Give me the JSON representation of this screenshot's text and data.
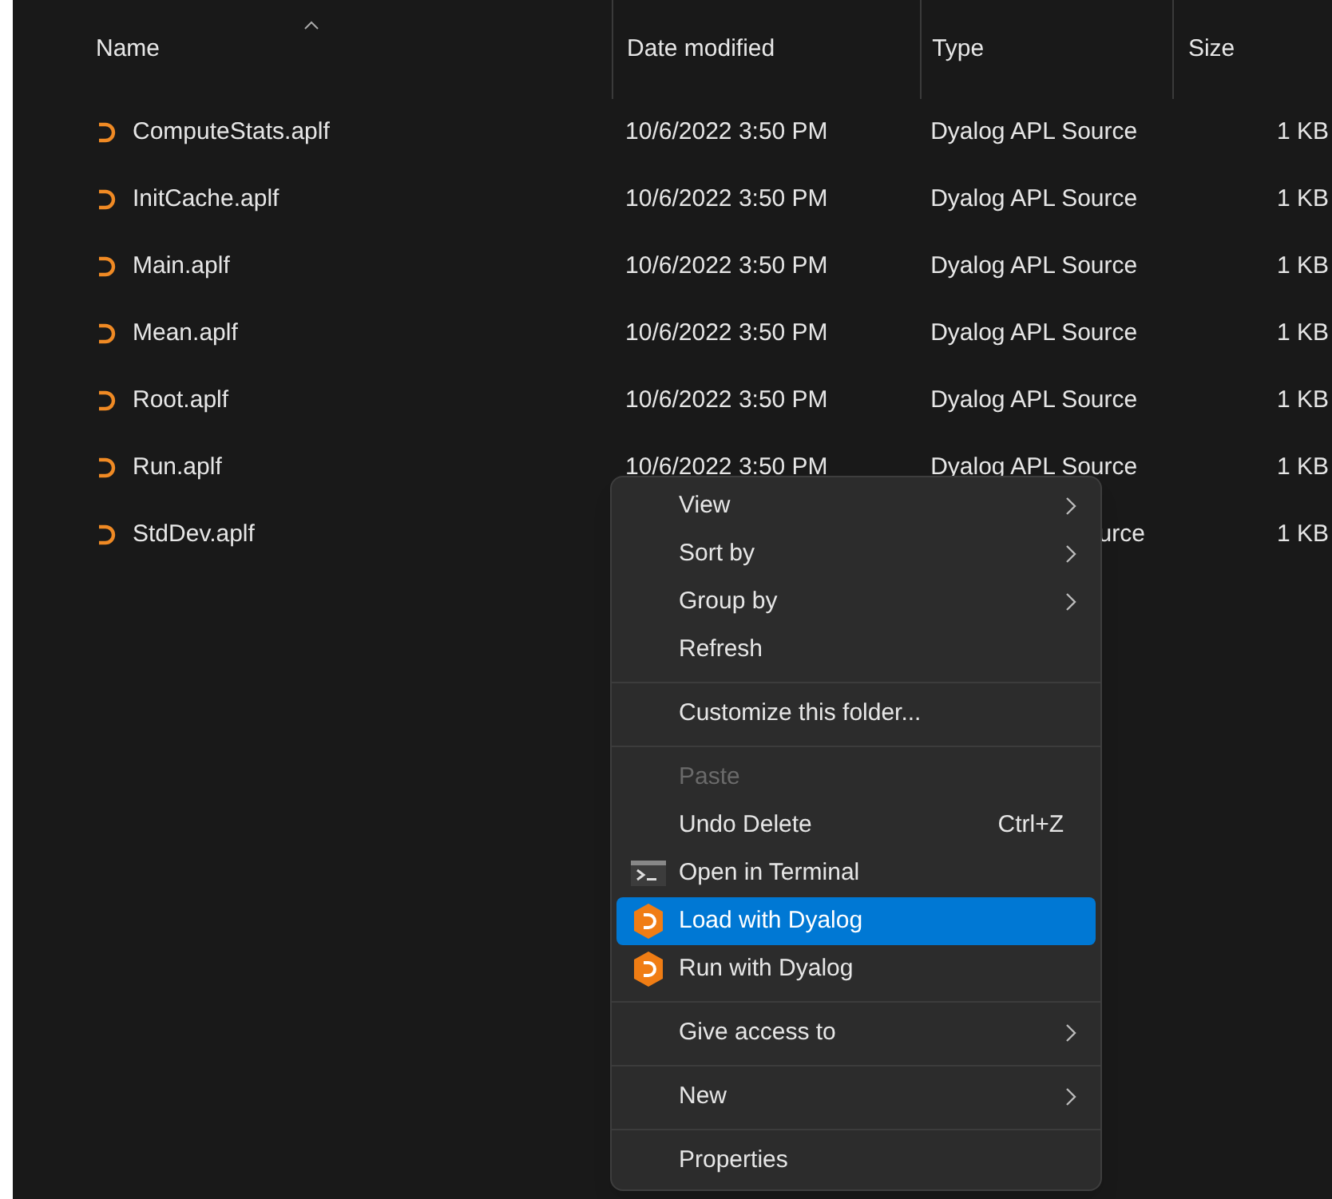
{
  "table": {
    "columns": [
      {
        "label": "Name",
        "sorted": true
      },
      {
        "label": "Date modified",
        "sorted": false
      },
      {
        "label": "Type",
        "sorted": false
      },
      {
        "label": "Size",
        "sorted": false
      }
    ],
    "rows": [
      {
        "name": "ComputeStats.aplf",
        "date": "10/6/2022 3:50 PM",
        "type": "Dyalog APL Source",
        "size": "1 KB"
      },
      {
        "name": "InitCache.aplf",
        "date": "10/6/2022 3:50 PM",
        "type": "Dyalog APL Source",
        "size": "1 KB"
      },
      {
        "name": "Main.aplf",
        "date": "10/6/2022 3:50 PM",
        "type": "Dyalog APL Source",
        "size": "1 KB"
      },
      {
        "name": "Mean.aplf",
        "date": "10/6/2022 3:50 PM",
        "type": "Dyalog APL Source",
        "size": "1 KB"
      },
      {
        "name": "Root.aplf",
        "date": "10/6/2022 3:50 PM",
        "type": "Dyalog APL Source",
        "size": "1 KB"
      },
      {
        "name": "Run.aplf",
        "date": "10/6/2022 3:50 PM",
        "type": "Dyalog APL Source",
        "size": "1 KB"
      },
      {
        "name": "StdDev.aplf",
        "type_visible_end": "urce",
        "size": "1 KB"
      }
    ]
  },
  "context_menu": {
    "items": [
      {
        "kind": "item",
        "label": "View",
        "submenu": true,
        "disabled": false,
        "selected": false
      },
      {
        "kind": "item",
        "label": "Sort by",
        "submenu": true,
        "disabled": false,
        "selected": false
      },
      {
        "kind": "item",
        "label": "Group by",
        "submenu": true,
        "disabled": false,
        "selected": false
      },
      {
        "kind": "item",
        "label": "Refresh",
        "submenu": false,
        "disabled": false,
        "selected": false
      },
      {
        "kind": "separator"
      },
      {
        "kind": "item",
        "label": "Customize this folder...",
        "submenu": false,
        "disabled": false,
        "selected": false
      },
      {
        "kind": "separator"
      },
      {
        "kind": "item",
        "label": "Paste",
        "submenu": false,
        "disabled": true,
        "selected": false
      },
      {
        "kind": "item",
        "label": "Undo Delete",
        "shortcut": "Ctrl+Z",
        "submenu": false,
        "disabled": false,
        "selected": false
      },
      {
        "kind": "terminal",
        "label": "Open in Terminal",
        "submenu": false,
        "disabled": false,
        "selected": false
      },
      {
        "kind": "app",
        "label": "Load with Dyalog",
        "submenu": false,
        "disabled": false,
        "selected": true
      },
      {
        "kind": "app",
        "label": "Run with Dyalog",
        "submenu": false,
        "disabled": false,
        "selected": false
      },
      {
        "kind": "separator"
      },
      {
        "kind": "item",
        "label": "Give access to",
        "submenu": true,
        "disabled": false,
        "selected": false
      },
      {
        "kind": "separator"
      },
      {
        "kind": "item",
        "label": "New",
        "submenu": true,
        "disabled": false,
        "selected": false
      },
      {
        "kind": "separator"
      },
      {
        "kind": "item",
        "label": "Properties",
        "submenu": false,
        "disabled": false,
        "selected": false
      }
    ]
  }
}
